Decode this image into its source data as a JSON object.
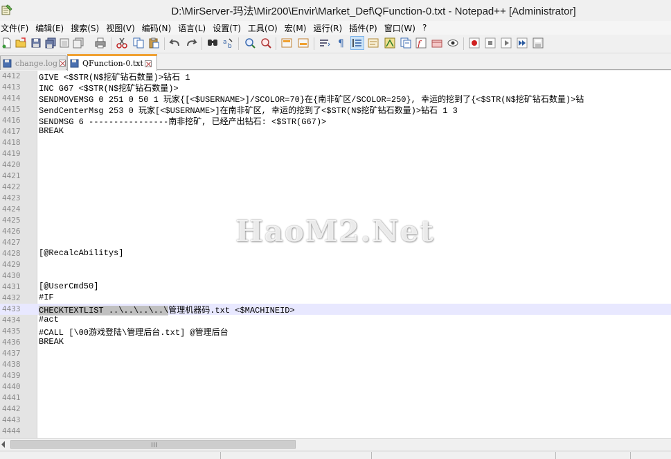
{
  "window": {
    "title": "D:\\MirServer-玛法\\Mir200\\Envir\\Market_Def\\QFunction-0.txt - Notepad++ [Administrator]"
  },
  "menu": [
    "文件(F)",
    "编辑(E)",
    "搜索(S)",
    "视图(V)",
    "编码(N)",
    "语言(L)",
    "设置(T)",
    "工具(O)",
    "宏(M)",
    "运行(R)",
    "插件(P)",
    "窗口(W)",
    "?"
  ],
  "tabs": [
    {
      "label": "change.log",
      "active": false
    },
    {
      "label": "QFunction-0.txt",
      "active": true
    }
  ],
  "editor": {
    "current_line": "4433",
    "lines": [
      {
        "n": "4412",
        "text": "GIVE <$STR(N$挖矿钻石数量)>钻石 1"
      },
      {
        "n": "4413",
        "text": "INC G67 <$STR(N$挖矿钻石数量)>"
      },
      {
        "n": "4414",
        "text": "SENDMOVEMSG 0 251 0 50 1 玩家{[<$USERNAME>]/SCOLOR=70}在{南非矿区/SCOLOR=250}, 幸运的挖到了{<$STR(N$挖矿钻石数量)>钻"
      },
      {
        "n": "4415",
        "text": "SendCenterMsg 253 0 玩家[<$USERNAME>]在南非矿区, 幸运的挖到了<$STR(N$挖矿钻石数量)>钻石 1 3"
      },
      {
        "n": "4416",
        "text": "SENDMSG 6 ----------------南非挖矿, 已经产出钻石: <$STR(G67)>"
      },
      {
        "n": "4417",
        "text": "BREAK"
      },
      {
        "n": "4418",
        "text": ""
      },
      {
        "n": "4419",
        "text": ""
      },
      {
        "n": "4420",
        "text": ""
      },
      {
        "n": "4421",
        "text": ""
      },
      {
        "n": "4422",
        "text": ""
      },
      {
        "n": "4423",
        "text": ""
      },
      {
        "n": "4424",
        "text": ""
      },
      {
        "n": "4425",
        "text": ""
      },
      {
        "n": "4426",
        "text": ""
      },
      {
        "n": "4427",
        "text": ""
      },
      {
        "n": "4428",
        "text": "[@RecalcAbilitys]"
      },
      {
        "n": "4429",
        "text": ""
      },
      {
        "n": "4430",
        "text": ""
      },
      {
        "n": "4431",
        "text": "[@UserCmd50]"
      },
      {
        "n": "4432",
        "text": "#IF"
      },
      {
        "n": "4433",
        "text": "CHECKTEXTLIST ..\\..\\..\\..\\管理机器码.txt <$MACHINEID>",
        "selected": "CHECKTEXTLIST ..\\..\\..\\..\\",
        "rest": "管理机器码.txt <$MACHINEID>"
      },
      {
        "n": "4434",
        "text": "#act"
      },
      {
        "n": "4435",
        "text": "#CALL [\\00游戏登陆\\管理后台.txt] @管理后台"
      },
      {
        "n": "4436",
        "text": "BREAK"
      },
      {
        "n": "4437",
        "text": ""
      },
      {
        "n": "4438",
        "text": ""
      },
      {
        "n": "4439",
        "text": ""
      },
      {
        "n": "4440",
        "text": ""
      },
      {
        "n": "4441",
        "text": ""
      },
      {
        "n": "4442",
        "text": ""
      },
      {
        "n": "4443",
        "text": ""
      },
      {
        "n": "4444",
        "text": ""
      }
    ]
  },
  "watermark": "HaoM2.Net",
  "colors": {
    "selection": "#c0c0c0",
    "current_line": "#e8e8ff",
    "active_tab_accent": "#f0a030"
  }
}
